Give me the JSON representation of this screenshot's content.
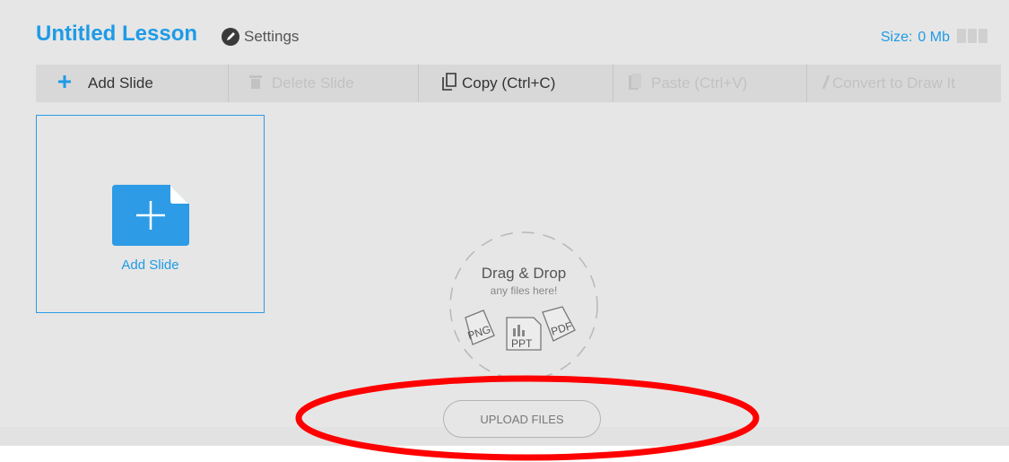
{
  "lesson": {
    "title": "Untitled Lesson",
    "settings_label": "Settings"
  },
  "size": {
    "label": "Size:",
    "value": "0 Mb"
  },
  "toolbar": {
    "add_slide": "Add Slide",
    "delete_slide": "Delete Slide",
    "copy": "Copy (Ctrl+C)",
    "paste": "Paste (Ctrl+V)",
    "convert": "Convert to Draw It"
  },
  "add_card": {
    "label": "Add Slide"
  },
  "dropzone": {
    "title": "Drag & Drop",
    "subtitle": "any files here!",
    "file_types": [
      "PNG",
      "PPT",
      "PDF"
    ]
  },
  "upload_button": "UPLOAD FILES",
  "colors": {
    "accent": "#1e9be6",
    "annotation": "#ff0000",
    "panel": "#e6e6e6"
  },
  "icons": [
    "pencil-icon",
    "plus-icon",
    "trash-icon",
    "copy-icon",
    "paste-icon",
    "pencil-draw-icon",
    "add-document-icon",
    "png-file-icon",
    "ppt-file-icon",
    "pdf-file-icon"
  ]
}
